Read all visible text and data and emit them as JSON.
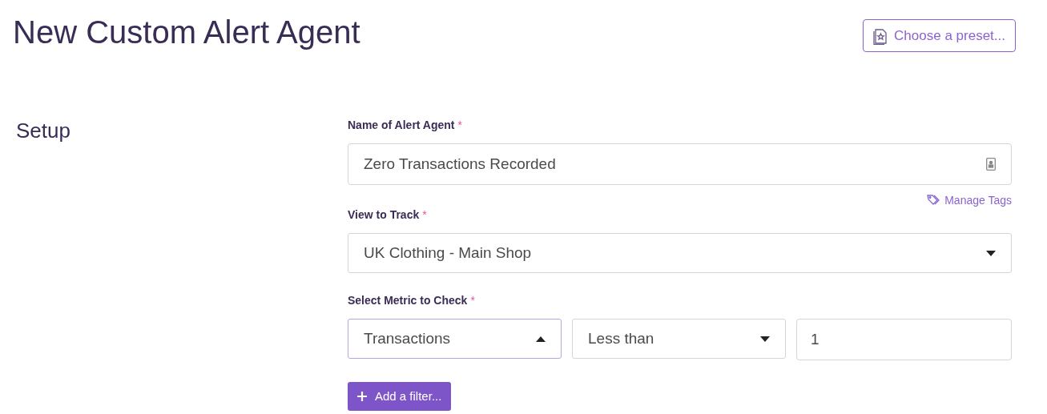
{
  "page_title": "New Custom Alert Agent",
  "preset_button": {
    "label": "Choose a preset..."
  },
  "section_title": "Setup",
  "name_field": {
    "label": "Name of Alert Agent",
    "required_mark": "*",
    "value": "Zero Transactions Recorded"
  },
  "manage_tags": {
    "label": "Manage Tags"
  },
  "view_field": {
    "label": "View to Track",
    "required_mark": "*",
    "value": "UK Clothing - Main Shop",
    "expanded": false
  },
  "metric_field": {
    "label": "Select Metric to Check",
    "required_mark": "*",
    "controls": [
      {
        "kind": "select",
        "value": "Transactions",
        "expanded": true
      },
      {
        "kind": "select",
        "value": "Less than",
        "expanded": false
      },
      {
        "kind": "input",
        "value": "1"
      }
    ]
  },
  "add_filter_button": {
    "label": "Add a filter..."
  }
}
